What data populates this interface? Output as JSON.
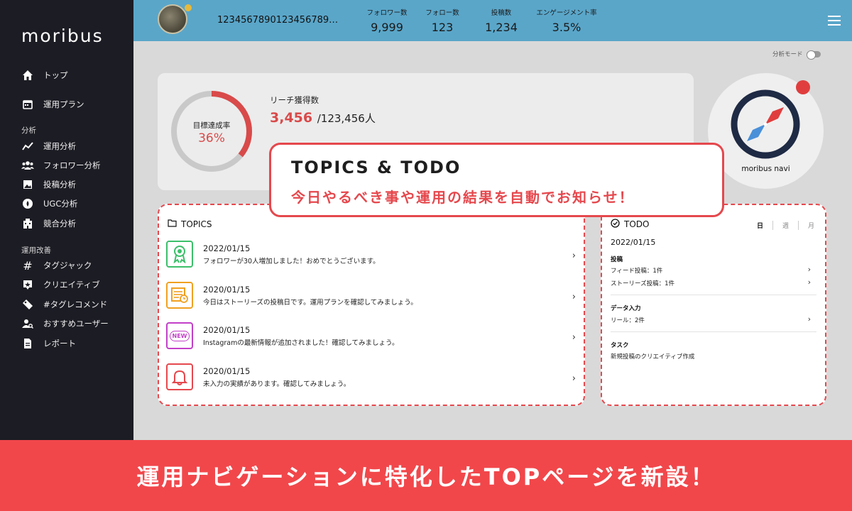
{
  "brand": {
    "logo": "moribus"
  },
  "sidebar": {
    "items": [
      {
        "label": "トップ",
        "icon": "home-icon"
      },
      {
        "label": "運用プラン",
        "icon": "calendar-icon"
      }
    ],
    "section_analysis": "分析",
    "analysis_items": [
      {
        "label": "運用分析",
        "icon": "trend-icon"
      },
      {
        "label": "フォロワー分析",
        "icon": "people-icon"
      },
      {
        "label": "投稿分析",
        "icon": "image-icon"
      },
      {
        "label": "UGC分析",
        "icon": "ugc-icon"
      },
      {
        "label": "競合分析",
        "icon": "building-icon"
      }
    ],
    "section_improve": "運用改善",
    "improve_items": [
      {
        "label": "タグジャック",
        "icon": "hash-icon"
      },
      {
        "label": "クリエイティブ",
        "icon": "creative-icon"
      },
      {
        "label": "#タグレコメンド",
        "icon": "tag-icon"
      },
      {
        "label": "おすすめユーザー",
        "icon": "user-search-icon"
      },
      {
        "label": "レポート",
        "icon": "report-icon"
      }
    ]
  },
  "header": {
    "username": "1234567890123456789…",
    "stats": [
      {
        "label": "フォロワー数",
        "value": "9,999"
      },
      {
        "label": "フォロー数",
        "value": "123"
      },
      {
        "label": "投稿数",
        "value": "1,234"
      },
      {
        "label": "エンゲージメント率",
        "value": "3.5%"
      }
    ]
  },
  "mode": {
    "label": "分析モード"
  },
  "reach": {
    "ring_label": "目標達成率",
    "ring_pct": "36%",
    "ring_fraction": 0.36,
    "title": "リーチ獲得数",
    "value": "3,456",
    "total": "/123,456人"
  },
  "navi": {
    "label": "moribus navi"
  },
  "callout": {
    "title": "TOPICS & TODO",
    "subtitle": "今日やるべき事や運用の結果を自動でお知らせ！"
  },
  "topics": {
    "title": "TOPICS",
    "items": [
      {
        "date": "2022/01/15",
        "text": "フォロワーが30人増加しました！おめでとうございます。",
        "icon": "award-icon",
        "color": "#3cbf6a",
        "glyph": "✪"
      },
      {
        "date": "2020/01/15",
        "text": "今日はストーリーズの投稿日です。運用プランを確認してみましょう。",
        "icon": "schedule-icon",
        "color": "#f0a020",
        "glyph": "▤"
      },
      {
        "date": "2020/01/15",
        "text": "Instagramの最新情報が追加されました！確認してみましょう。",
        "icon": "new-icon",
        "color": "#c23fc8",
        "glyph": "NEW"
      },
      {
        "date": "2020/01/15",
        "text": "未入力の実績があります。確認してみましょう。",
        "icon": "bell-icon",
        "color": "#e5484d",
        "glyph": "♫"
      }
    ]
  },
  "todo": {
    "title": "TODO",
    "tabs": [
      "日",
      "週",
      "月"
    ],
    "date": "2022/01/15",
    "cat_post": "投稿",
    "feed": "フィード投稿：1件",
    "story": "ストーリーズ投稿：1件",
    "cat_data": "データ入力",
    "reel": "リール：2件",
    "cat_task": "タスク",
    "task": "新規投稿のクリエイティブ作成"
  },
  "banner": {
    "text": "運用ナビゲーションに特化したTOPページを新設！"
  }
}
